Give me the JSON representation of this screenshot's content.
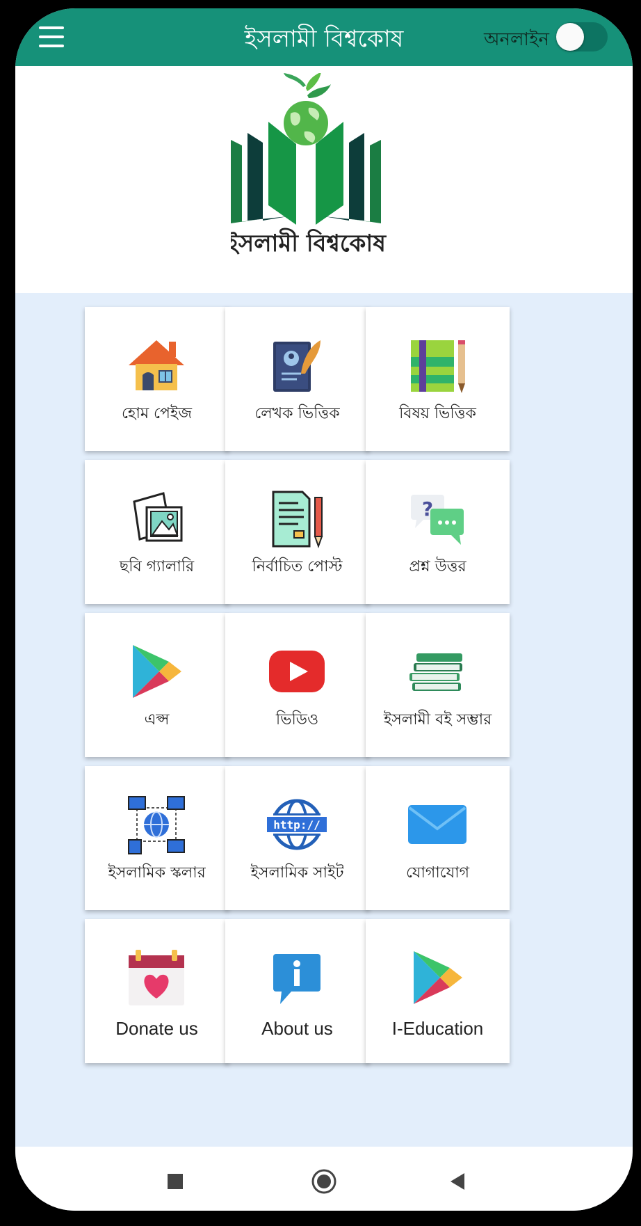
{
  "header": {
    "title": "ইসলামী বিশ্বকোষ",
    "online_label": "অনলাইন",
    "online_toggle": "off"
  },
  "logo": {
    "caption": "ইসলামী  বিশ্বকোষ"
  },
  "tiles": [
    {
      "label": "হোম পেইজ",
      "icon": "house-icon"
    },
    {
      "label": "লেখক ভিত্তিক",
      "icon": "author-book-icon"
    },
    {
      "label": "বিষয় ভিত্তিক",
      "icon": "subject-notebook-icon"
    },
    {
      "label": "ছবি গ্যালারি",
      "icon": "gallery-icon"
    },
    {
      "label": "নির্বাচিত পোস্ট",
      "icon": "selected-post-icon"
    },
    {
      "label": "প্রশ্ন উত্তর",
      "icon": "question-answer-icon"
    },
    {
      "label": "এপ্স",
      "icon": "play-store-icon"
    },
    {
      "label": "ভিডিও",
      "icon": "youtube-icon"
    },
    {
      "label": "ইসলামী বই সম্ভার",
      "icon": "books-stack-icon"
    },
    {
      "label": "ইসলামিক স্কলার",
      "icon": "network-globe-icon"
    },
    {
      "label": "ইসলামিক সাইট",
      "icon": "http-globe-icon"
    },
    {
      "label": "যোগাযোগ",
      "icon": "mail-icon"
    },
    {
      "label": "Donate us",
      "icon": "donate-heart-icon"
    },
    {
      "label": "About us",
      "icon": "info-icon"
    },
    {
      "label": "I-Education",
      "icon": "play-store-icon"
    }
  ],
  "navbar": {
    "recents": "recents-icon",
    "home": "home-icon",
    "back": "back-icon"
  },
  "colors": {
    "primary": "#169179",
    "background": "#e3eefb",
    "tile": "#ffffff"
  }
}
